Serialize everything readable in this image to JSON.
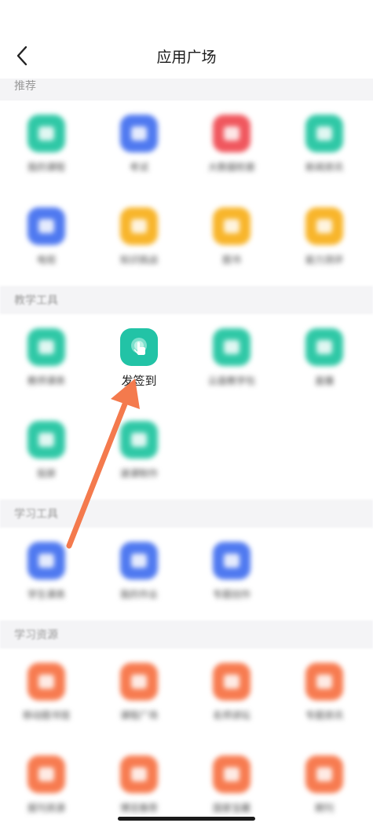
{
  "header": {
    "title": "应用广场",
    "back_icon": "chevron-left-icon"
  },
  "sections": [
    {
      "label": "推荐",
      "apps": [
        {
          "label": "我的课程",
          "color": "#2fc8a6",
          "icon": "course-icon"
        },
        {
          "label": "考试",
          "color": "#4f79f0",
          "icon": "exam-icon"
        },
        {
          "label": "大数据检索",
          "color": "#f0575e",
          "icon": "search-data-icon"
        },
        {
          "label": "新闻资讯",
          "color": "#2fc8a6",
          "icon": "news-icon"
        },
        {
          "label": "电视",
          "color": "#4f79f0",
          "icon": "tv-icon"
        },
        {
          "label": "知识挑战",
          "color": "#f8b52b",
          "icon": "challenge-icon"
        },
        {
          "label": "图书",
          "color": "#f8b52b",
          "icon": "book-icon"
        },
        {
          "label": "能力测评",
          "color": "#f8b52b",
          "icon": "assessment-icon"
        }
      ]
    },
    {
      "label": "教学工具",
      "apps": [
        {
          "label": "教师课表",
          "color": "#2fc8a6",
          "icon": "schedule-icon"
        },
        {
          "label": "发签到",
          "color": "#22c3a6",
          "icon": "tap-sign-in-icon",
          "highlighted": true
        },
        {
          "label": "云盘教学包",
          "color": "#2fc8a6",
          "icon": "cloud-package-icon"
        },
        {
          "label": "直播",
          "color": "#2fc8a6",
          "icon": "live-icon"
        },
        {
          "label": "投屏",
          "color": "#2fc8a6",
          "icon": "screen-cast-icon"
        },
        {
          "label": "速课制作",
          "color": "#2fc8a6",
          "icon": "quick-course-icon"
        }
      ]
    },
    {
      "label": "学习工具",
      "apps": [
        {
          "label": "学生课表",
          "color": "#4f79f0",
          "icon": "student-schedule-icon"
        },
        {
          "label": "我的作业",
          "color": "#4f79f0",
          "icon": "homework-icon"
        },
        {
          "label": "专题创作",
          "color": "#4f79f0",
          "icon": "topic-icon"
        }
      ]
    },
    {
      "label": "学习资源",
      "apps": [
        {
          "label": "移动图书馆",
          "color": "#f77b50",
          "icon": "library-icon"
        },
        {
          "label": "课程广场",
          "color": "#f77b50",
          "icon": "course-plaza-icon"
        },
        {
          "label": "名师讲坛",
          "color": "#f77b50",
          "icon": "lecture-icon"
        },
        {
          "label": "专题资讯",
          "color": "#f77b50",
          "icon": "topic-news-icon"
        },
        {
          "label": "报刊资源",
          "color": "#f77b50",
          "icon": "newspaper-icon"
        },
        {
          "label": "博览推荐",
          "color": "#f77b50",
          "icon": "recommend-icon"
        },
        {
          "label": "国家宝藏",
          "color": "#f77b50",
          "icon": "treasure-icon"
        },
        {
          "label": "期刊",
          "color": "#f77b50",
          "icon": "journal-icon"
        }
      ]
    }
  ],
  "annotation": {
    "arrow_color": "#f47a4d"
  }
}
